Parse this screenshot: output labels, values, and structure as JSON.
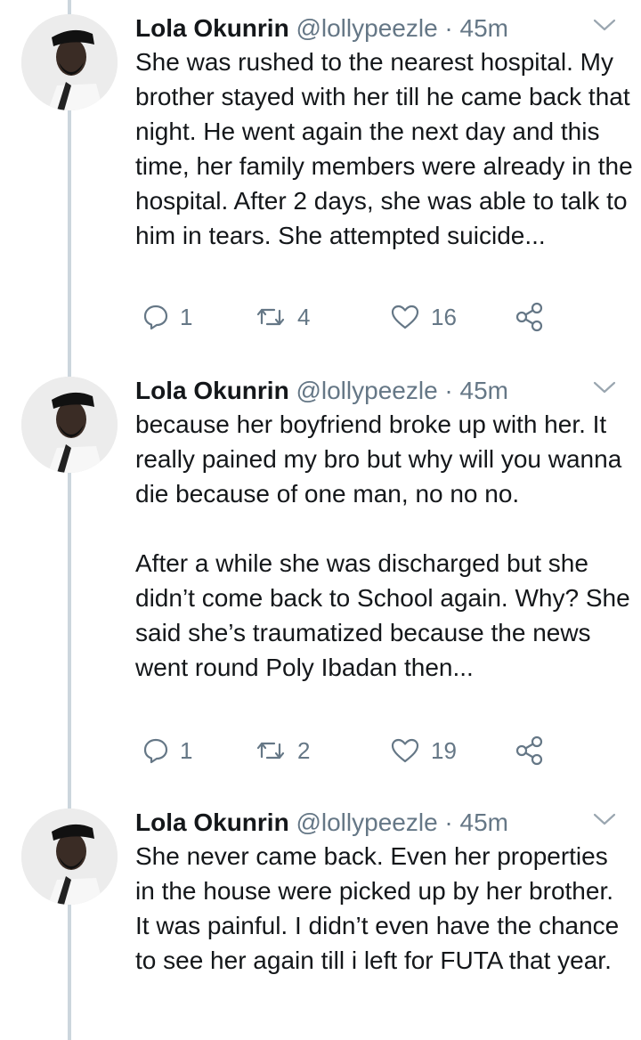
{
  "tweets": [
    {
      "name": "Lola Okunrin",
      "handle": "@lollypeezle",
      "separator": "·",
      "time": "45m",
      "paragraphs": [
        "She was rushed to the nearest hospital. My brother stayed with her till he came back that night. He went again the next day and this time, her family members were already in the hospital. After 2 days, she was able to talk to him in tears. She attempted suicide..."
      ],
      "replies": "1",
      "retweets": "4",
      "likes": "16"
    },
    {
      "name": "Lola Okunrin",
      "handle": "@lollypeezle",
      "separator": "·",
      "time": "45m",
      "paragraphs": [
        "because her boyfriend broke up with her. It really pained my bro but why will you wanna die because of one man, no no no.",
        "After a while she was discharged but she didn’t come back to School again. Why? She said she’s traumatized because the news went round Poly Ibadan then..."
      ],
      "replies": "1",
      "retweets": "2",
      "likes": "19"
    },
    {
      "name": "Lola Okunrin",
      "handle": "@lollypeezle",
      "separator": "·",
      "time": "45m",
      "paragraphs": [
        "She never came back. Even her properties in the house were picked up by her brother. It was painful. I didn’t even have the chance to see her again till i left for FUTA that year."
      ]
    }
  ],
  "icons": {
    "reply": "reply-icon",
    "retweet": "retweet-icon",
    "like": "heart-icon",
    "share": "share-icon",
    "menu": "chevron-down-icon"
  },
  "colors": {
    "text": "#14171a",
    "muted": "#657786",
    "thread_line": "#ccd6dd"
  }
}
